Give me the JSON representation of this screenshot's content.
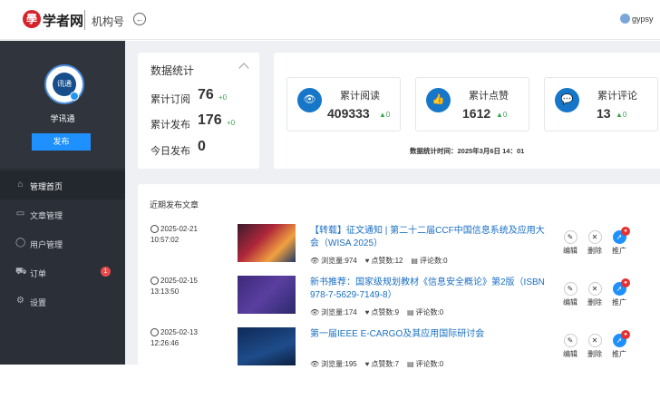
{
  "header": {
    "logo_char": "學",
    "brand": "学者网",
    "org_label": "机构号",
    "back_icon": "←",
    "user_name": "gypsy"
  },
  "sidebar": {
    "profile_name": "学讯通",
    "avatar_text": "讯通",
    "publish_label": "发布",
    "items": [
      {
        "label": "管理首页",
        "icon": "⌂"
      },
      {
        "label": "文章管理",
        "icon": "▭"
      },
      {
        "label": "用户管理",
        "icon": "◯"
      },
      {
        "label": "订单",
        "icon": "⛟",
        "badge": "1"
      },
      {
        "label": "设置",
        "icon": "⚙"
      }
    ]
  },
  "stats": {
    "title": "数据统计",
    "rows": [
      {
        "label": "累计订阅",
        "value": "76",
        "delta": "+0"
      },
      {
        "label": "累计发布",
        "value": "176",
        "delta": "+0"
      },
      {
        "label": "今日发布",
        "value": "0"
      }
    ]
  },
  "metrics": {
    "items": [
      {
        "label": "累计阅读",
        "value": "409333",
        "delta": "0",
        "icon": "👁"
      },
      {
        "label": "累计点赞",
        "value": "1612",
        "delta": "0",
        "icon": "👍"
      },
      {
        "label": "累计评论",
        "value": "13",
        "delta": "0",
        "icon": "💬"
      }
    ],
    "time_label": "数据统计时间：2025年3月6日  14：01"
  },
  "articles": {
    "title": "近期发布文章",
    "list": [
      {
        "date": "2025-02-21",
        "time": "10:57:02",
        "title": "【转载】征文通知 | 第二十二届CCF中国信息系统及应用大会（WISA 2025）",
        "views": "浏览量:974",
        "likes": "点赞数:12",
        "comments": "评论数:0"
      },
      {
        "date": "2025-02-15",
        "time": "13:13:50",
        "title": "新书推荐：国家级规划教材《信息安全概论》第2版（ISBN 978-7-5629-7149-8）",
        "views": "浏览量:174",
        "likes": "点赞数:9",
        "comments": "评论数:0"
      },
      {
        "date": "2025-02-13",
        "time": "12:26:46",
        "title": "第一届IEEE E-CARGO及其应用国际研讨会",
        "views": "浏览量:195",
        "likes": "点赞数:7",
        "comments": "评论数:0"
      }
    ],
    "actions": {
      "edit": "编辑",
      "delete": "删除",
      "promote": "推广"
    }
  }
}
